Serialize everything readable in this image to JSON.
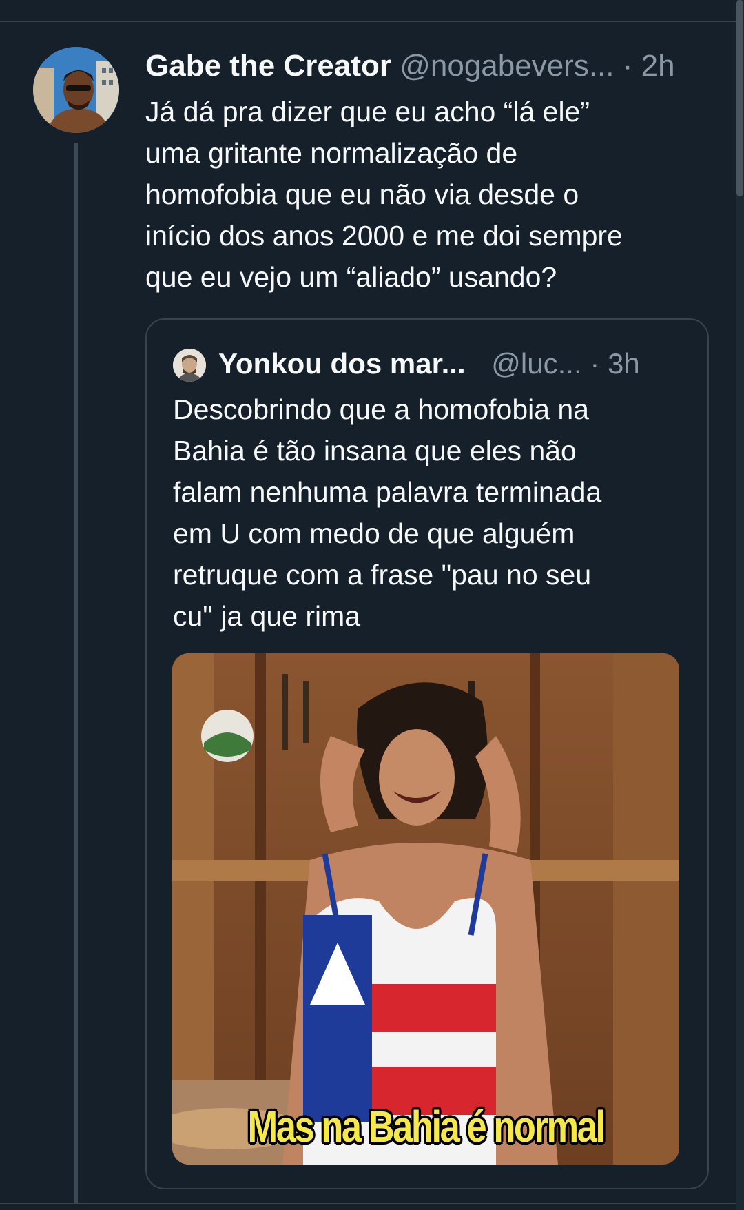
{
  "tweet": {
    "display_name": "Gabe the Creator",
    "handle": "@nogabevers...",
    "separator": "·",
    "time": "2h",
    "text": "Já dá pra dizer que eu acho “lá ele”\numa gritante normalização de\nhomofobia que eu não via desde o\ninício dos anos 2000 e me doi sempre\nque eu vejo um “aliado” usando?",
    "avatar_icon": "profile-photo"
  },
  "quoted_tweet": {
    "display_name": "Yonkou dos mar...",
    "handle": "@luc...",
    "separator": "·",
    "time": "3h",
    "text": "Descobrindo que a homofobia na\nBahia é tão insana que eles não\nfalam nenhuma palavra terminada\nem U com medo de que alguém\nretruque com a frase \"pau no seu\ncu\" ja que rima",
    "avatar_icon": "profile-photo",
    "media": {
      "type": "image",
      "caption": "Mas na Bahia é normal"
    }
  },
  "colors": {
    "background": "#15202b",
    "border": "#38444d",
    "secondary_text": "#8b98a5",
    "primary_text": "#f7f9f9",
    "caption_yellow": "#f5e84a"
  }
}
